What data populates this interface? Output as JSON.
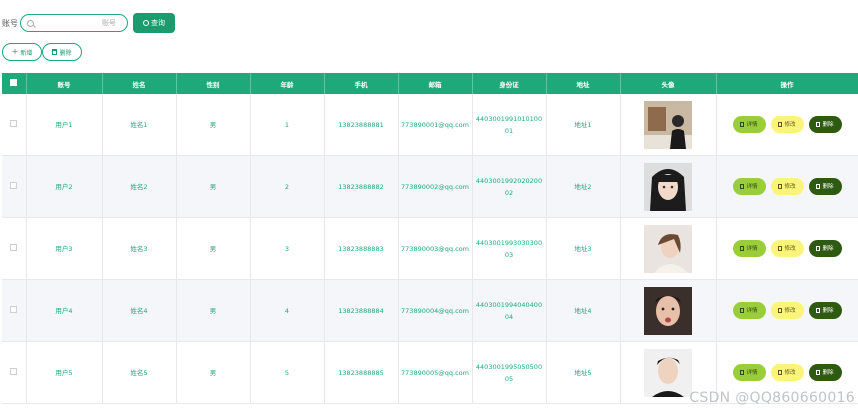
{
  "search": {
    "label": "账号",
    "placeholder": "账号",
    "button_label": "查询"
  },
  "toolbar": {
    "add_label": "新增",
    "delete_label": "删除"
  },
  "table": {
    "headers": [
      "账号",
      "姓名",
      "性别",
      "年龄",
      "手机",
      "邮箱",
      "身份证",
      "地址",
      "头像",
      "操作"
    ],
    "rows": [
      {
        "account": "用户1",
        "name": "姓名1",
        "gender": "男",
        "age": "1",
        "phone": "13823888881",
        "email": "773890001@qq.com",
        "id_card": "440300199101010001",
        "address": "地址1",
        "avatar": "avatar-1"
      },
      {
        "account": "用户2",
        "name": "姓名2",
        "gender": "男",
        "age": "2",
        "phone": "13823888882",
        "email": "773890002@qq.com",
        "id_card": "440300199202020002",
        "address": "地址2",
        "avatar": "avatar-2"
      },
      {
        "account": "用户3",
        "name": "姓名3",
        "gender": "男",
        "age": "3",
        "phone": "13823888883",
        "email": "773890003@qq.com",
        "id_card": "440300199303030003",
        "address": "地址3",
        "avatar": "avatar-3"
      },
      {
        "account": "用户4",
        "name": "姓名4",
        "gender": "男",
        "age": "4",
        "phone": "13823888884",
        "email": "773890004@qq.com",
        "id_card": "440300199404040004",
        "address": "地址4",
        "avatar": "avatar-4"
      },
      {
        "account": "用户5",
        "name": "姓名5",
        "gender": "男",
        "age": "5",
        "phone": "13823888885",
        "email": "773890005@qq.com",
        "id_card": "440300199505050005",
        "address": "地址5",
        "avatar": "avatar-5"
      }
    ],
    "row_actions": {
      "detail_label": "详情",
      "edit_label": "修改",
      "delete_label": "删除"
    }
  },
  "watermark": "CSDN @QQ860660016",
  "colors": {
    "primary": "#1ea97a",
    "detail": "#9acd3a",
    "edit": "#fbf47a",
    "delete": "#2f5a12"
  }
}
